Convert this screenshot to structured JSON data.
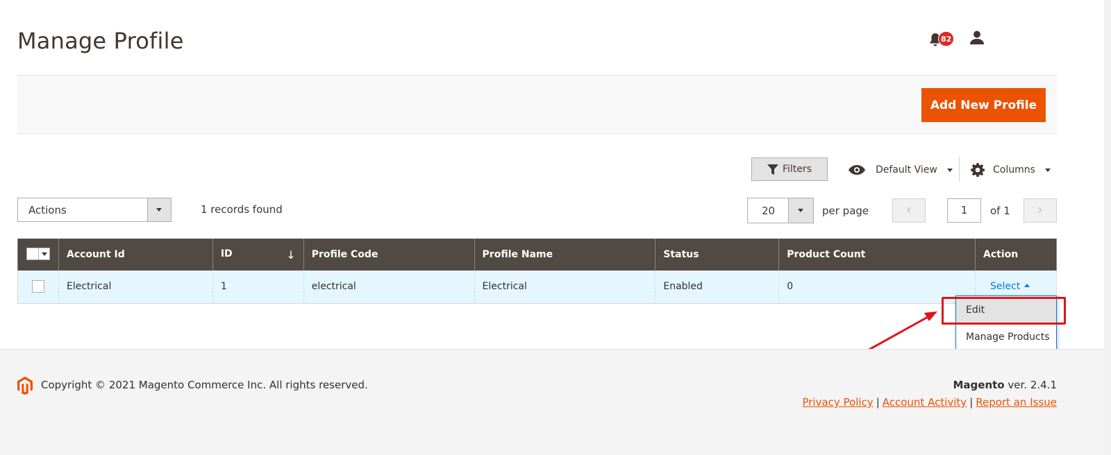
{
  "page": {
    "title": "Manage Profile",
    "notification_count": "82"
  },
  "action_bar": {
    "add_button": "Add New Profile"
  },
  "toolbar": {
    "filters_label": "Filters",
    "view_label": "Default View",
    "columns_label": "Columns",
    "actions_label": "Actions",
    "records_found": "1 records found",
    "per_page_value": "20",
    "per_page_label": "per page",
    "current_page": "1",
    "page_of": "of 1"
  },
  "grid": {
    "columns": [
      "Account Id",
      "ID",
      "Profile Code",
      "Profile Name",
      "Status",
      "Product Count",
      "Action"
    ],
    "rows": [
      {
        "account_id": "Electrical",
        "id": "1",
        "profile_code": "electrical",
        "profile_name": "Electrical",
        "status": "Enabled",
        "product_count": "0",
        "action": "Select"
      }
    ],
    "action_menu": [
      "Edit",
      "Manage Products"
    ]
  },
  "footer": {
    "copyright": "Copyright © 2021 Magento Commerce Inc. All rights reserved.",
    "brand": "Magento",
    "version": " ver. 2.4.1",
    "links": [
      "Privacy Policy",
      "Account Activity",
      "Report an Issue"
    ]
  },
  "colors": {
    "accent": "#eb5202",
    "header_bg": "#514943",
    "row_bg": "#e5f7fe",
    "link": "#007bdb",
    "annotation": "#e0131b"
  }
}
